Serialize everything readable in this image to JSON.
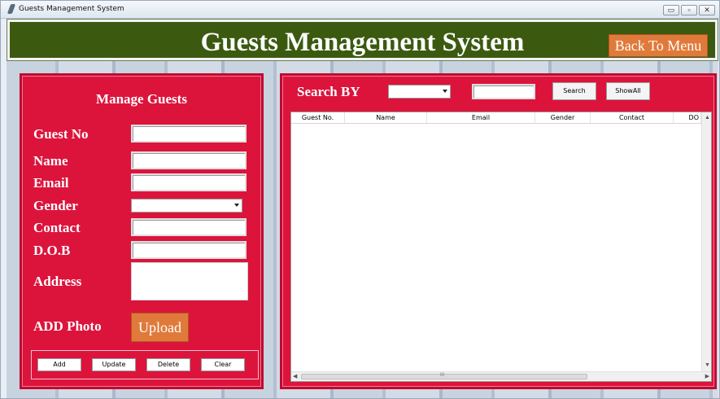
{
  "window": {
    "title": "Guests Management System",
    "controls": [
      "▭",
      "▫",
      "✕"
    ]
  },
  "header": {
    "title": "Guests Management System",
    "back_button": "Back To Menu"
  },
  "manage": {
    "title": "Manage Guests",
    "labels": {
      "guest_no": "Guest No",
      "name": "Name",
      "email": "Email",
      "gender": "Gender",
      "contact": "Contact",
      "dob": "D.O.B",
      "address": "Address",
      "add_photo": "ADD Photo"
    },
    "values": {
      "guest_no": "",
      "name": "",
      "email": "",
      "gender": "",
      "contact": "",
      "dob": "",
      "address": ""
    },
    "upload_button": "Upload",
    "buttons": {
      "add": "Add",
      "update": "Update",
      "delete": "Delete",
      "clear": "Clear"
    }
  },
  "search": {
    "label": "Search BY",
    "by_value": "",
    "query": "",
    "search_button": "Search",
    "show_all_button": "ShowAll"
  },
  "table": {
    "columns": [
      "Guest No.",
      "Name",
      "Email",
      "Gender",
      "Contact",
      "DO"
    ],
    "rows": [],
    "scroll_mid": "III"
  },
  "colors": {
    "header_bg": "#3b5a10",
    "panel_bg": "#dc143c",
    "accent_button": "#e07a3a"
  }
}
